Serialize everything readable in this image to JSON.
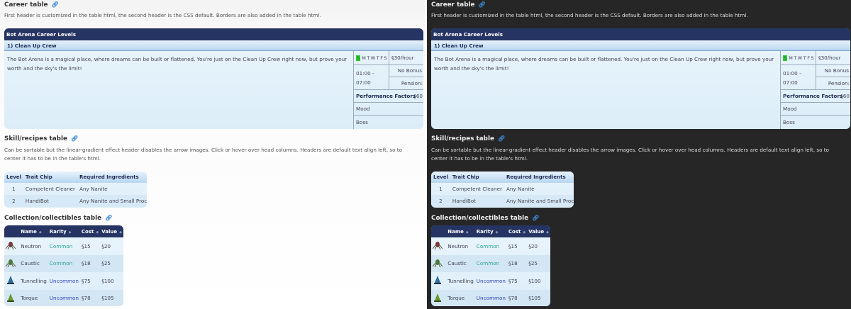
{
  "career": {
    "heading": "Career table",
    "link_icon": "link-icon",
    "description": "First header is customized in the table html, the second header is the CSS default. Borders are also added in the table html.",
    "table_title": "Bot Arena Career Levels",
    "level": "1) Clean Up Crew",
    "body": "The Bot Arena is a magical place, where dreams can be built or flattened. You're just on the Clean Up Crew right now, but prove your worth and the sky's the limit!",
    "schedule_active": "S",
    "schedule_rest": "MTWTFS",
    "pay": "§30/hour",
    "hours": "01:00 - 07:00",
    "bonus": "No Bonus",
    "pension": "Pension: §60",
    "perf_header": "Performance Factors",
    "factors": [
      "Mood",
      "Boss"
    ]
  },
  "skill": {
    "heading": "Skill/recipes table",
    "description": "Can be sortable but the linear-gradient effect header disables the arrow images. Click or hover over head columns. Headers are default text align left, so to center it has to be in the table's html.",
    "headers": [
      "Level",
      "Trait Chip",
      "Required Ingredients"
    ],
    "rows": [
      [
        "1",
        "Competent Cleaner",
        "Any Nanite"
      ],
      [
        "2",
        "HandiBot",
        "Any Nanite and Small Processor"
      ]
    ]
  },
  "collection": {
    "heading": "Collection/collectibles table",
    "headers": [
      "Name",
      "Rarity",
      "Cost",
      "Value"
    ],
    "rows": [
      [
        "Neutron",
        "Common",
        "§15",
        "§20"
      ],
      [
        "Caustic",
        "Common",
        "§18",
        "§25"
      ],
      [
        "Tunnelling",
        "Uncommon",
        "§75",
        "§100"
      ],
      [
        "Torque",
        "Uncommon",
        "§78",
        "§105"
      ]
    ]
  },
  "colors": {
    "header": "#263463",
    "common": "#2aa595",
    "uncommon": "#3448b5",
    "dark_bg": "#262626"
  }
}
